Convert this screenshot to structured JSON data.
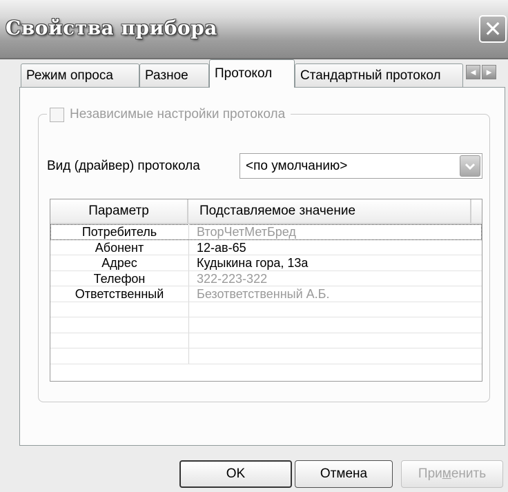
{
  "window": {
    "title": "Свойства прибора",
    "close_icon": "close-icon"
  },
  "tabs": [
    {
      "label": "Режим опроса",
      "active": false
    },
    {
      "label": "Разное",
      "active": false
    },
    {
      "label": "Протокол",
      "active": true
    },
    {
      "label": "Стандартный протокол",
      "active": false
    }
  ],
  "tab_scroll": {
    "left": "◄",
    "right": "►"
  },
  "group": {
    "checkbox_label": "Независимые настройки протокола",
    "checked": false,
    "enabled": false
  },
  "protocol": {
    "label": "Вид (драйвер) протокола",
    "selected": "<по умолчанию>"
  },
  "grid": {
    "headers": [
      "Параметр",
      "Подставляемое значение"
    ],
    "rows": [
      {
        "param": "Потребитель",
        "value": "ВторЧетМетБред",
        "muted": true
      },
      {
        "param": "Абонент",
        "value": "12-ав-65",
        "muted": false
      },
      {
        "param": "Адрес",
        "value": "Кудыкина гора, 13а",
        "muted": false
      },
      {
        "param": "Телефон",
        "value": "322-223-322",
        "muted": true
      },
      {
        "param": "Ответственный",
        "value": "Безответственный А.Б.",
        "muted": true
      },
      {
        "param": "",
        "value": "",
        "muted": false
      },
      {
        "param": "",
        "value": "",
        "muted": false
      },
      {
        "param": "",
        "value": "",
        "muted": false
      },
      {
        "param": "",
        "value": "",
        "muted": false
      }
    ]
  },
  "buttons": {
    "ok": "OK",
    "cancel": "Отмена",
    "apply_prefix": "При",
    "apply_accel": "м",
    "apply_suffix": "енить",
    "apply_enabled": false
  }
}
